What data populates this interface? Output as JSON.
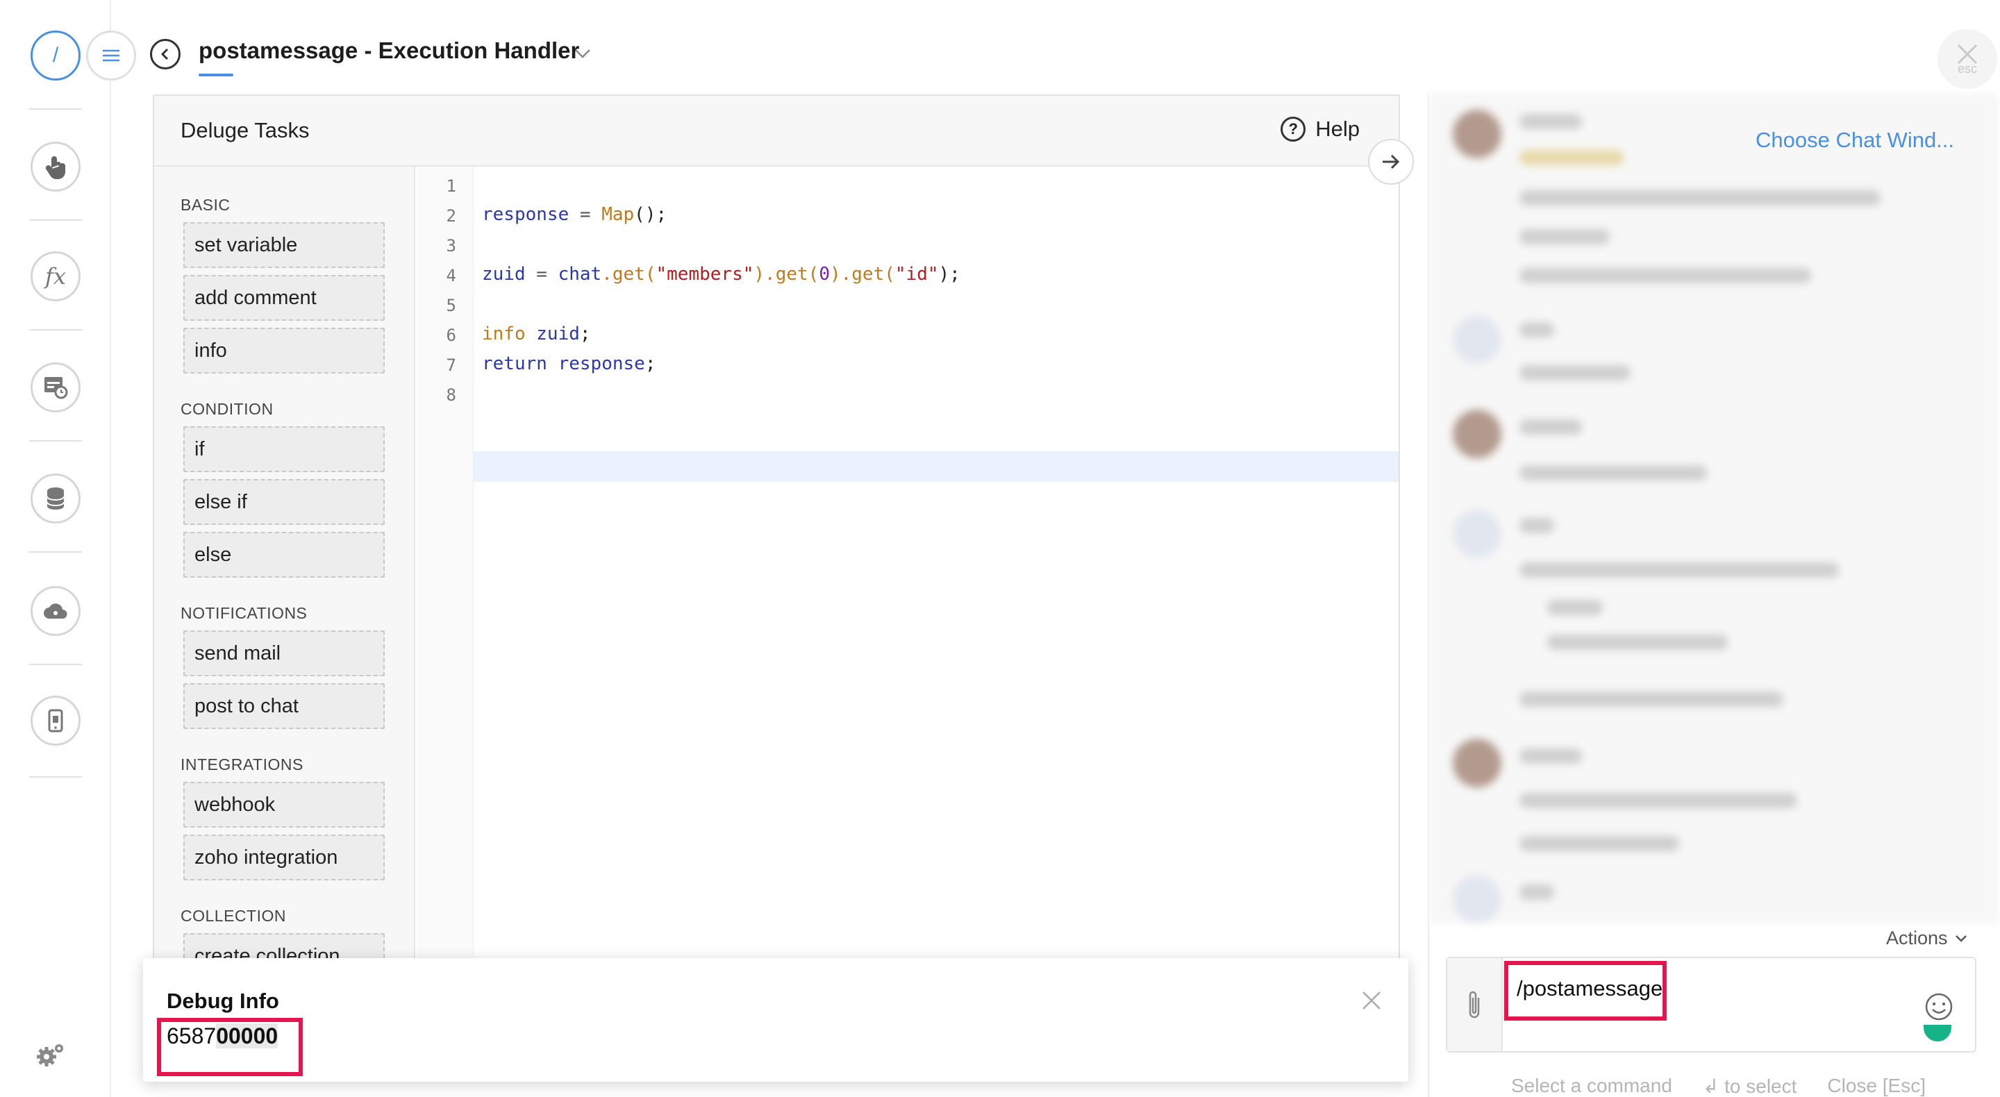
{
  "header": {
    "title": "postamessage  -  Execution Handler",
    "esc_label": "esc"
  },
  "rail": {
    "slash_label": "/"
  },
  "editor": {
    "tasks_title": "Deluge Tasks",
    "help_label": "Help",
    "categories": [
      {
        "name": "BASIC",
        "items": [
          "set variable",
          "add comment",
          "info"
        ]
      },
      {
        "name": "CONDITION",
        "items": [
          "if",
          "else if",
          "else"
        ]
      },
      {
        "name": "NOTIFICATIONS",
        "items": [
          "send mail",
          "post to chat"
        ]
      },
      {
        "name": "INTEGRATIONS",
        "items": [
          "webhook",
          "zoho integration"
        ]
      },
      {
        "name": "COLLECTION",
        "items": [
          "create collection"
        ]
      }
    ],
    "line_numbers": [
      "1",
      "2",
      "3",
      "4",
      "5",
      "6",
      "7",
      "8"
    ],
    "code": {
      "l2": {
        "var": "response",
        "op": " = ",
        "fn": "Map",
        "tail": "();"
      },
      "l4": {
        "var": "zuid",
        "op": " = ",
        "obj": "chat",
        "m1": ".get(",
        "s1": "\"members\"",
        "m2": ").get(",
        "n1": "0",
        "m3": ").get(",
        "s2": "\"id\"",
        "tail": ");"
      },
      "l6": {
        "kw": "info",
        "sp": " ",
        "var": "zuid",
        "tail": ";"
      },
      "l7": {
        "kw": "return",
        "sp": " ",
        "var": "response",
        "tail": ";"
      }
    }
  },
  "debug": {
    "title": "Debug Info",
    "value_prefix": "6587",
    "value_suffix": "00000"
  },
  "chat": {
    "choose_link": "Choose Chat Wind...",
    "actions_label": "Actions",
    "input_value": "/postamessage",
    "hints": [
      "Select a command",
      "↲ to select",
      "Close [Esc]"
    ]
  },
  "colors": {
    "accent": "#4a90e2",
    "highlight_box": "#e5154f"
  }
}
